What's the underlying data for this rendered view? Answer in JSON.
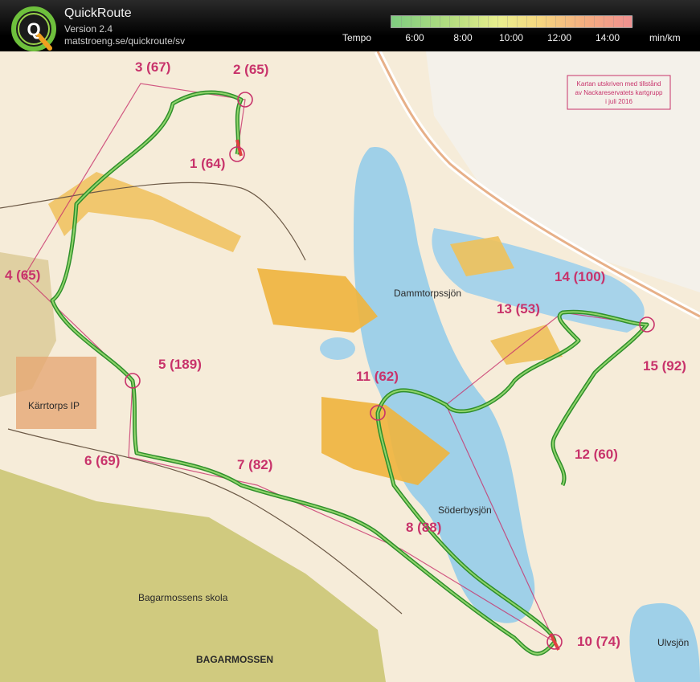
{
  "header": {
    "logo_letter": "Q",
    "app_title": "QuickRoute",
    "app_version": "Version 2.4",
    "app_url": "matstroeng.se/quickroute/sv"
  },
  "legend": {
    "label": "Tempo",
    "unit": "min/km",
    "ticks": [
      "6:00",
      "8:00",
      "10:00",
      "12:00",
      "14:00"
    ],
    "colors": [
      "#69c46a",
      "#a8d86a",
      "#e6ec7a",
      "#f5d06a",
      "#f3a16a",
      "#ee7d7d"
    ]
  },
  "map": {
    "notice_lines": [
      "Kartan utskriven med tillstånd",
      "av Nackareservatets kartgrupp",
      "i juli 2016"
    ],
    "places": {
      "dammtorpssjon": "Dammtorpssjön",
      "soderbysjon": "Söderbysjön",
      "ulvsjon": "Ulvsjön",
      "kartorps_ip": "Kärrtorps IP",
      "bagarmossen": "BAGARMOSSEN",
      "bagarmossen_skola": "Bagarmossens skola"
    },
    "controls": [
      {
        "id": "1",
        "label": "1 (64)"
      },
      {
        "id": "2",
        "label": "2 (65)"
      },
      {
        "id": "3",
        "label": "3 (67)"
      },
      {
        "id": "4",
        "label": "4 (65)"
      },
      {
        "id": "5",
        "label": "5 (189)"
      },
      {
        "id": "6",
        "label": "6 (69)"
      },
      {
        "id": "7",
        "label": "7 (82)"
      },
      {
        "id": "8",
        "label": "8 (88)"
      },
      {
        "id": "10",
        "label": "10 (74)"
      },
      {
        "id": "11",
        "label": "11 (62)"
      },
      {
        "id": "12",
        "label": "12 (60)"
      },
      {
        "id": "13",
        "label": "13 (53)"
      },
      {
        "id": "14",
        "label": "14 (100)"
      },
      {
        "id": "15",
        "label": "15 (92)"
      }
    ],
    "colors": {
      "paper": "#f6ecd9",
      "forest_white": "#faf6ee",
      "water": "#9fd0e8",
      "open_yellow": "#f0b43c",
      "urban": "#c8c26a",
      "route_green": "#3fa83a",
      "control_magenta": "#c8336b"
    }
  }
}
